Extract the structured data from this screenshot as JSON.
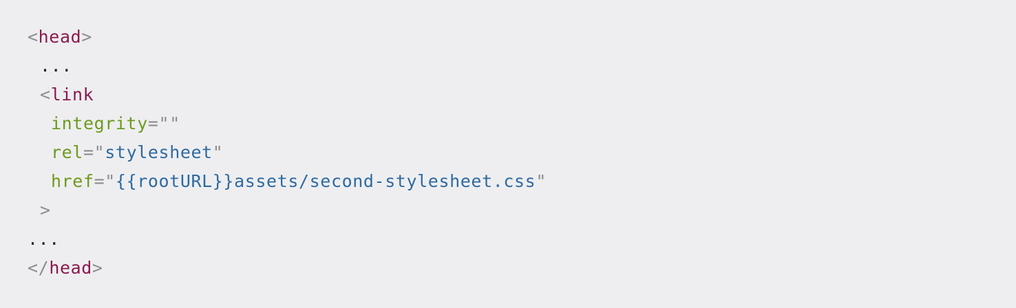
{
  "code": {
    "head_open": {
      "lt": "<",
      "name": "head",
      "gt": ">"
    },
    "ellipsis_inner": "...",
    "link_open": {
      "lt": "<",
      "name": "link"
    },
    "attributes": [
      {
        "name": "integrity",
        "eq": "=",
        "quote_open": "\"",
        "value": "",
        "quote_close": "\""
      },
      {
        "name": "rel",
        "eq": "=",
        "quote_open": "\"",
        "value": "stylesheet",
        "quote_close": "\""
      },
      {
        "name": "href",
        "eq": "=",
        "quote_open": "\"",
        "value": "{{rootURL}}assets/second-stylesheet.css",
        "quote_close": "\""
      }
    ],
    "link_close": ">",
    "ellipsis_outer": "...",
    "head_close": {
      "lt": "</",
      "name": "head",
      "gt": ">"
    }
  },
  "colors": {
    "background": "#eeeef0",
    "punctuation": "#8c8c8c",
    "tag": "#8a1a4f",
    "attribute": "#6e9a1e",
    "value": "#2e6aa0",
    "text": "#222222"
  }
}
